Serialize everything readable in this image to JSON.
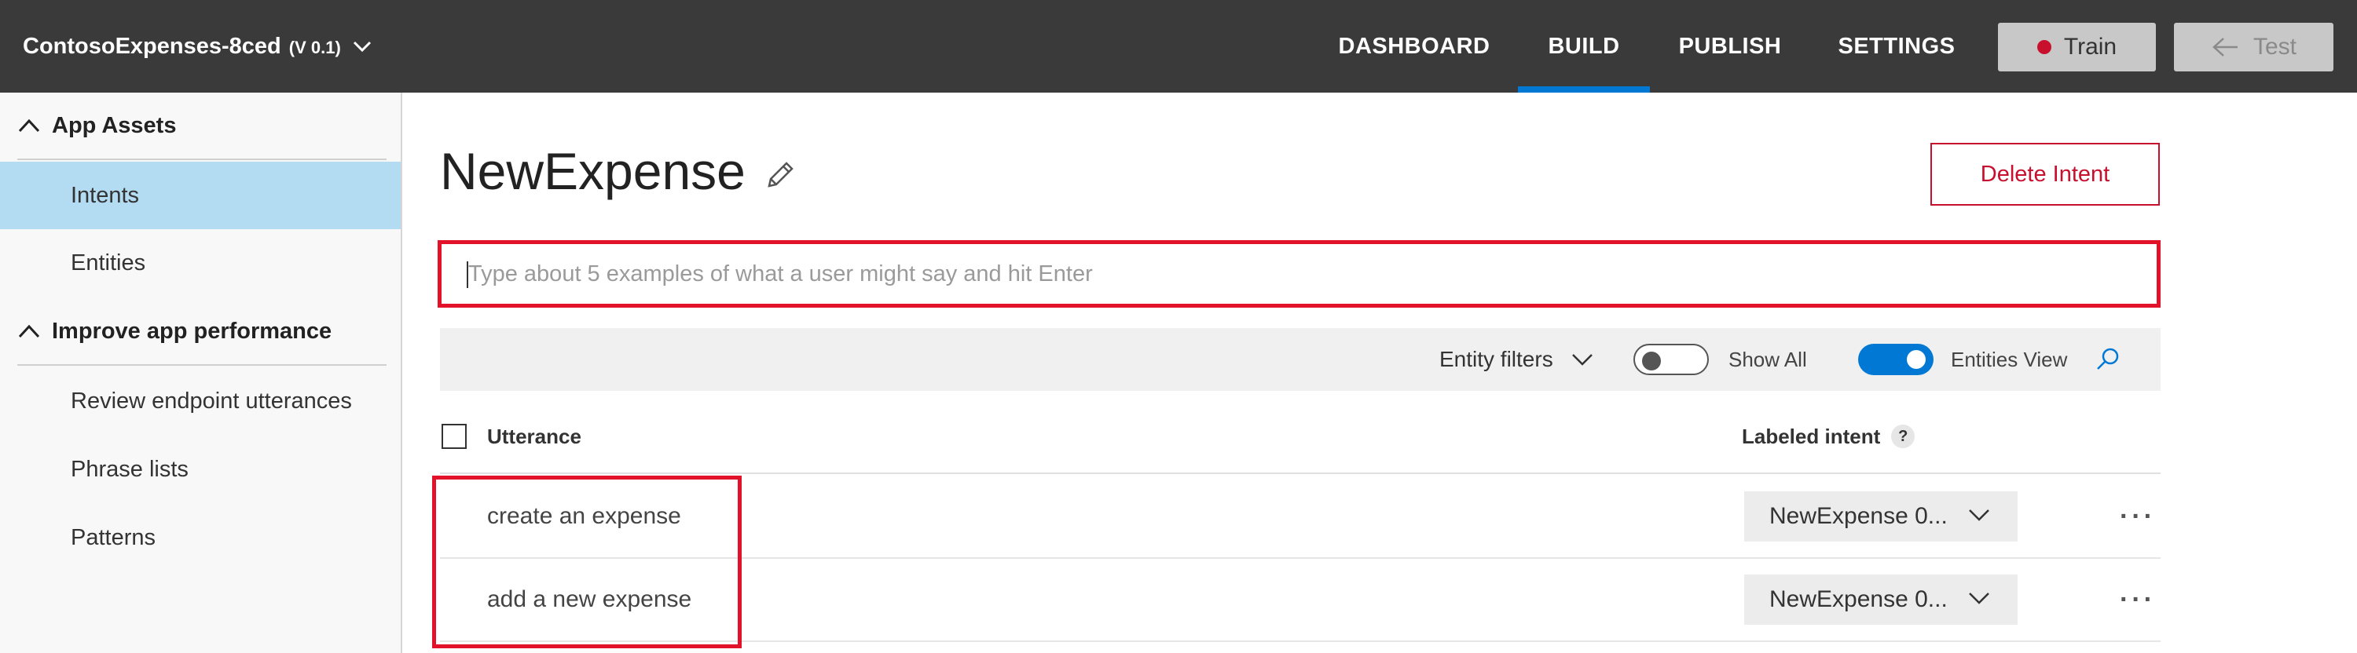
{
  "app": {
    "name": "ContosoExpenses-8ced",
    "version": "(V 0.1)"
  },
  "nav": {
    "tabs": [
      {
        "label": "DASHBOARD"
      },
      {
        "label": "BUILD"
      },
      {
        "label": "PUBLISH"
      },
      {
        "label": "SETTINGS"
      }
    ],
    "active": "BUILD"
  },
  "toolbar": {
    "train_label": "Train",
    "test_label": "Test"
  },
  "sidebar": {
    "section1": "App Assets",
    "items1": [
      "Intents",
      "Entities"
    ],
    "selected": "Intents",
    "section2": "Improve app performance",
    "items2": [
      "Review endpoint utterances",
      "Phrase lists",
      "Patterns"
    ]
  },
  "intent": {
    "title": "NewExpense",
    "delete_label": "Delete Intent"
  },
  "utterance_input": {
    "placeholder": "Type about 5 examples of what a user might say and hit Enter",
    "value": ""
  },
  "filters": {
    "entity_filters": "Entity filters",
    "show_all": "Show All",
    "show_all_on": false,
    "entities_view": "Entities View",
    "entities_view_on": true
  },
  "table": {
    "headers": {
      "utterance": "Utterance",
      "labeled_intent": "Labeled intent",
      "help": "?"
    },
    "rows": [
      {
        "utterance": "create an expense",
        "intent": "NewExpense 0..."
      },
      {
        "utterance": "add a new expense",
        "intent": "NewExpense 0..."
      }
    ],
    "more_label": "···"
  },
  "colors": {
    "topbar": "#3a3a3a",
    "accent": "#0078d4",
    "danger": "#c8102e",
    "selected": "#b3dcf2"
  }
}
